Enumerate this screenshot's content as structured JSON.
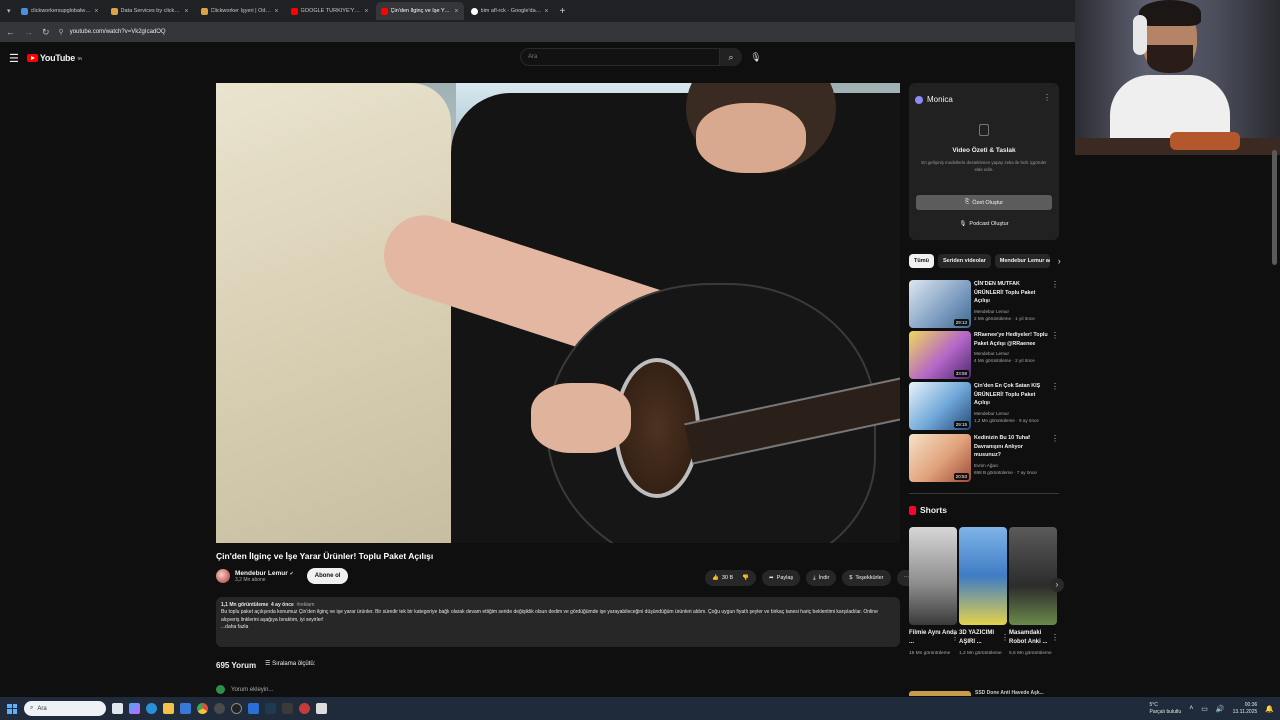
{
  "browser": {
    "tabs": [
      {
        "label": "clickworkersupglobalwallet.com",
        "color": "#4a8fe0",
        "active": false
      },
      {
        "label": "Data Services by clickworker",
        "color": "#d9a441",
        "active": false
      },
      {
        "label": "Clickworker İşyeri | Ödeme Ayr.",
        "color": "#d9a441",
        "active": false
      },
      {
        "label": "GOOGLE TÜRKİYE'YE GELİYOR",
        "color": "#ff0000",
        "active": false
      },
      {
        "label": "Çin'den İlginç ve İşe Yarar Ürün",
        "color": "#ff0000",
        "active": true
      },
      {
        "label": "bim afl-rck - Google'da Ara",
        "color": "#ffffff",
        "active": false
      }
    ],
    "new_tab": "+",
    "url": "youtube.com/watch?v=Vk2gIcadOQ"
  },
  "youtube": {
    "logo": "YouTube",
    "logo_sup": "TR",
    "search_placeholder": "Ara"
  },
  "video": {
    "title": "Çin'den İlginç ve İşe Yarar Ürünler! Toplu Paket Açılışı",
    "channel": "Mendebur Lemur",
    "subscribers": "3,2 Mn abone",
    "subscribe_label": "Abone ol",
    "likes": "30 B",
    "share_label": "Paylaş",
    "download_label": "İndir",
    "thanks_label": "Teşekkürler",
    "description": {
      "views": "1,1 Mn görüntüleme",
      "age": "4 ay önce",
      "tag": "#reklam",
      "text": "Bu toplu paket açılışında konumuz Çin'den ilginç ve işe yarar ürünler. Bir süredir tek bir kategoriye bağlı olarak devam ettiğim seride değişiklik olsun dedim ve gördüğümde işe yarayabileceğini düşündüğüm ürünleri aldım. Çoğu uygun fiyatlı şeyler ve birkaç tanesi hariç beklentimi karşıladılar. Online alışveriş linklerini aşağıya bıraktım, iyi seyirler!",
      "more": "...daha fazla"
    },
    "comments_count": "695 Yorum",
    "sort_label": "Sıralama ölçütü:",
    "add_comment": "Yorum ekleyin..."
  },
  "monica": {
    "title": "Monica",
    "heading": "Video Özeti & Taslak",
    "text": "En gelişmiş modellerle desteklenen yapay zeka ile hızlı içgörüler elde edin.",
    "button1": "Özet Oluştur",
    "button2": "Podcast Oluştur"
  },
  "chips": [
    "Tümü",
    "Seriden videolar",
    "Mendebur Lemur adlı"
  ],
  "recommended": [
    {
      "title": "ÇİN'DEN MUTFAK ÜRÜNLERİ! Toplu Paket Açılışı",
      "channel": "Mendebur Lemur",
      "meta": "2 Mn görüntüleme · 1 yıl önce",
      "duration": "29:13",
      "color": "#7d9cc0"
    },
    {
      "title": "RRaenee'ye Hediyeler! Toplu Paket Açılışı @RRaenee",
      "channel": "Mendebur Lemur",
      "meta": "4 Mn görüntüleme · 2 yıl önce",
      "duration": "33:58",
      "color": "#b567c9"
    },
    {
      "title": "Çin'den En Çok Satan KIŞ ÜRÜNLERİ! Toplu Paket Açılışı",
      "channel": "Mendebur Lemur",
      "meta": "1,2 Mn görüntüleme · 9 ay önce",
      "duration": "29:15",
      "color": "#6fa7d8"
    },
    {
      "title": "Kedinizin Bu 10 Tuhaf Davranışını Anlıyor musunuz?",
      "channel": "Evrim Ağacı",
      "meta": "698 B görüntüleme · 7 ay önce",
      "duration": "20:53",
      "color": "#e0a27a"
    }
  ],
  "shorts": {
    "heading": "Shorts",
    "items": [
      {
        "title": "Filmie Aynı Anda ...",
        "views": "16 Mn görüntüleme",
        "color": "#8a8a8a"
      },
      {
        "title": "3D YAZICIMI AŞIRI ...",
        "views": "1,2 Mn görüntüleme",
        "color": "#3f7cc4"
      },
      {
        "title": "Masamdaki Robot Anki ...",
        "views": "5,6 Mn görüntüleme",
        "color": "#2c2c2c"
      }
    ],
    "next_title": "SSD Done Anti Havede Aşk..."
  },
  "taskbar": {
    "search_placeholder": "Ara",
    "weather_temp": "5°C",
    "weather_desc": "Parçalı bulutlu",
    "time": "00:36",
    "date": "13.11.2025"
  }
}
